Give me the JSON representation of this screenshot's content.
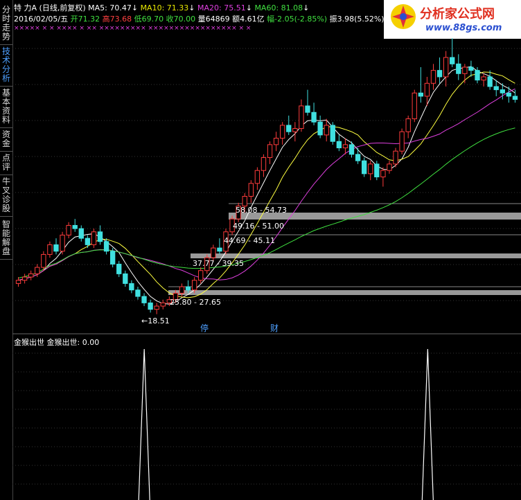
{
  "side_tabs": [
    "分时走势",
    "技术分析",
    "基本资料",
    "资金",
    "点评",
    "牛叉诊股",
    "智能解盘"
  ],
  "header": {
    "code": "特",
    "name": "力A",
    "period": "(日线,前复权)",
    "ma5": "MA5: 70.47",
    "ma10": "MA10: 71.33",
    "ma20": "MA20: 75.51",
    "ma60": "MA60: 81.08",
    "date": "2016/02/05/五",
    "open": "开71.32",
    "high": "高73.68",
    "low": "低69.70",
    "close": "收70.00",
    "volume": "量64869",
    "amount": "额4.61亿",
    "change": "幅-2.05(-2.85%)",
    "amplitude": "振3.98(5.52%)"
  },
  "marks": {
    "row": "×××××   ×   ×      ××××  ×      ××  ×××××××××  ×××××××××××××××××  ×  ×"
  },
  "logo": {
    "text": "分析家公式网",
    "url": "www.88gs.com"
  },
  "markers": [
    "停",
    "财"
  ],
  "sub": {
    "title": "金猴出世",
    "label": "金猴出世: 0.00"
  },
  "colors": {
    "up": "#ff3c3c",
    "down": "#40e0e0",
    "ma5": "#ffffff",
    "ma10": "#ffff40",
    "ma20": "#e040e0",
    "ma60": "#40e040",
    "band": "#999999"
  },
  "chart_data": {
    "type": "candlestick",
    "price_labels": [
      "18.51",
      "25.80 - 27.65",
      "37.77 - 39.35",
      "44.69 - 45.11",
      "49.16 - 51.00",
      "58.08 - 54.73"
    ],
    "candles": [
      [
        28,
        30,
        27,
        29
      ],
      [
        29,
        31,
        28,
        30
      ],
      [
        30,
        32,
        29,
        31
      ],
      [
        31,
        34,
        30,
        33
      ],
      [
        33,
        38,
        32,
        37
      ],
      [
        37,
        41,
        36,
        40
      ],
      [
        40,
        42,
        37,
        38
      ],
      [
        38,
        44,
        37,
        43
      ],
      [
        43,
        47,
        42,
        46
      ],
      [
        46,
        48,
        44,
        45
      ],
      [
        45,
        46,
        41,
        42
      ],
      [
        42,
        43,
        39,
        40
      ],
      [
        40,
        45,
        39,
        44
      ],
      [
        44,
        46,
        40,
        41
      ],
      [
        41,
        42,
        37,
        38
      ],
      [
        38,
        39,
        33,
        34
      ],
      [
        34,
        35,
        30,
        31
      ],
      [
        31,
        32,
        27,
        28
      ],
      [
        28,
        29,
        25,
        26
      ],
      [
        26,
        27,
        23,
        24
      ],
      [
        24,
        25,
        21,
        22
      ],
      [
        22,
        23,
        19,
        20
      ],
      [
        20,
        22,
        18.5,
        21
      ],
      [
        21,
        23,
        20,
        22
      ],
      [
        22,
        24,
        21,
        23
      ],
      [
        23,
        26,
        22,
        25
      ],
      [
        25,
        28,
        24,
        27
      ],
      [
        27,
        29,
        25,
        26
      ],
      [
        26,
        30,
        25,
        29
      ],
      [
        29,
        33,
        28,
        32
      ],
      [
        32,
        37,
        31,
        36
      ],
      [
        36,
        40,
        35,
        39
      ],
      [
        39,
        42,
        37,
        38
      ],
      [
        38,
        45,
        37,
        44
      ],
      [
        44,
        49,
        43,
        48
      ],
      [
        48,
        53,
        47,
        52
      ],
      [
        52,
        56,
        50,
        55
      ],
      [
        55,
        60,
        53,
        59
      ],
      [
        59,
        64,
        57,
        63
      ],
      [
        63,
        68,
        61,
        67
      ],
      [
        67,
        72,
        65,
        71
      ],
      [
        71,
        75,
        69,
        73
      ],
      [
        73,
        78,
        71,
        77
      ],
      [
        77,
        80,
        74,
        75
      ],
      [
        75,
        78,
        72,
        76
      ],
      [
        76,
        85,
        75,
        83
      ],
      [
        83,
        88,
        80,
        81
      ],
      [
        81,
        84,
        77,
        78
      ],
      [
        78,
        80,
        73,
        74
      ],
      [
        74,
        79,
        72,
        77
      ],
      [
        77,
        78,
        71,
        72
      ],
      [
        72,
        74,
        69,
        70
      ],
      [
        70,
        73,
        68,
        71
      ],
      [
        71,
        72,
        67,
        68
      ],
      [
        68,
        70,
        65,
        66
      ],
      [
        66,
        67,
        61,
        62
      ],
      [
        62,
        66,
        60,
        65
      ],
      [
        65,
        66,
        60,
        61
      ],
      [
        61,
        64,
        58,
        63
      ],
      [
        63,
        66,
        62,
        65
      ],
      [
        65,
        70,
        64,
        69
      ],
      [
        69,
        76,
        68,
        75
      ],
      [
        75,
        80,
        73,
        79
      ],
      [
        79,
        88,
        78,
        87
      ],
      [
        87,
        95,
        84,
        86
      ],
      [
        86,
        92,
        83,
        90
      ],
      [
        90,
        96,
        88,
        94
      ],
      [
        94,
        98,
        90,
        92
      ],
      [
        92,
        100,
        89,
        98
      ],
      [
        98,
        104,
        95,
        96
      ],
      [
        96,
        99,
        91,
        93
      ],
      [
        93,
        96,
        90,
        95
      ],
      [
        95,
        97,
        92,
        94
      ],
      [
        94,
        95,
        90,
        91
      ],
      [
        91,
        93,
        89,
        92
      ],
      [
        92,
        94,
        88,
        89
      ],
      [
        89,
        91,
        86,
        88
      ],
      [
        88,
        90,
        85,
        87
      ],
      [
        87,
        89,
        84,
        86
      ],
      [
        86,
        88,
        84,
        85
      ]
    ],
    "signal_peaks": [
      22,
      64
    ]
  }
}
